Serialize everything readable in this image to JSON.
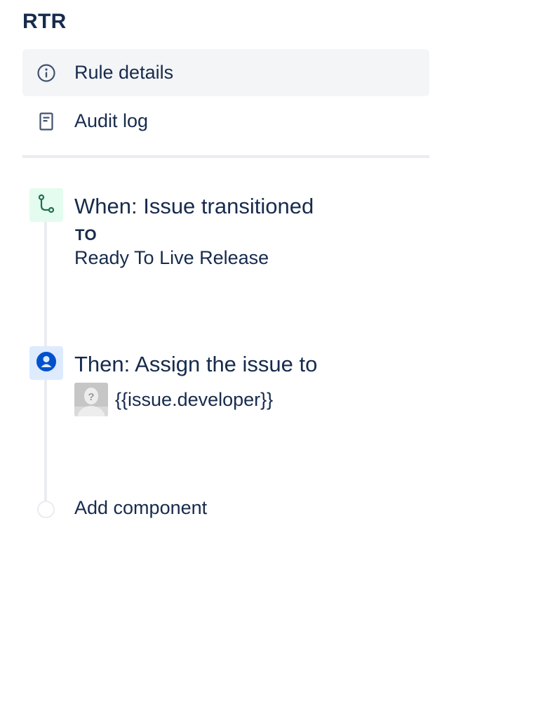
{
  "rule": {
    "name": "RTR"
  },
  "nav": {
    "items": [
      {
        "label": "Rule details",
        "icon": "info-icon",
        "active": true
      },
      {
        "label": "Audit log",
        "icon": "document-icon",
        "active": false
      }
    ]
  },
  "components": {
    "trigger": {
      "title": "When: Issue transitioned",
      "sub_label": "TO",
      "sub_value": "Ready To Live Release",
      "icon": "branch-icon",
      "color": "#E3FCEF"
    },
    "action": {
      "title": "Then: Assign the issue to",
      "assignee": "{{issue.developer}}",
      "icon": "user-circle-icon",
      "color": "#DEEBFF"
    },
    "add": {
      "label": "Add component"
    }
  },
  "colors": {
    "text": "#172B4D",
    "active_bg": "#F4F5F7",
    "divider": "#EBECF0",
    "trigger_green": "#36B37E",
    "action_blue": "#0052CC"
  }
}
